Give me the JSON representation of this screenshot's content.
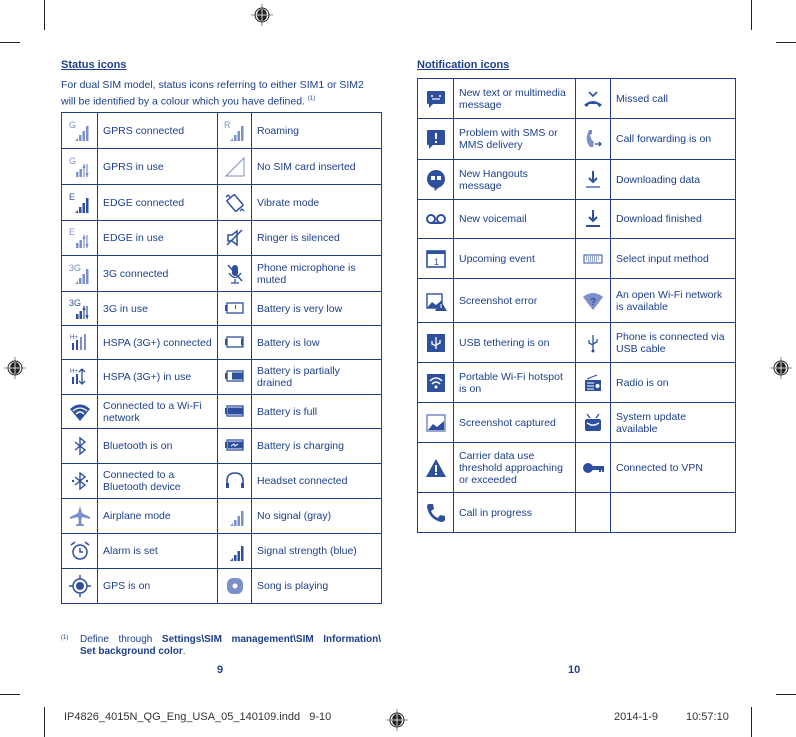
{
  "status_section": {
    "title": "Status icons",
    "intro": "For dual SIM model, status icons referring to either SIM1 or SIM2 will be identified by a colour which you have defined.",
    "intro_footnote_ref": "(1)",
    "rows": [
      {
        "left_icon": "gprs-connected-icon",
        "left": "GPRS connected",
        "right_icon": "roaming-icon",
        "right": "Roaming"
      },
      {
        "left_icon": "gprs-in-use-icon",
        "left": "GPRS in use",
        "right_icon": "no-sim-icon",
        "right": "No SIM card inserted"
      },
      {
        "left_icon": "edge-connected-icon",
        "left": "EDGE connected",
        "right_icon": "vibrate-icon",
        "right": "Vibrate mode"
      },
      {
        "left_icon": "edge-in-use-icon",
        "left": "EDGE in use",
        "right_icon": "ringer-silenced-icon",
        "right": "Ringer is silenced"
      },
      {
        "left_icon": "3g-connected-icon",
        "left": "3G connected",
        "right_icon": "mic-muted-icon",
        "right": "Phone microphone is muted"
      },
      {
        "left_icon": "3g-in-use-icon",
        "left": "3G in use",
        "right_icon": "battery-very-low-icon",
        "right": "Battery is very low"
      },
      {
        "left_icon": "hspa-connected-icon",
        "left": "HSPA (3G+) connected",
        "right_icon": "battery-low-icon",
        "right": "Battery is low"
      },
      {
        "left_icon": "hspa-in-use-icon",
        "left": "HSPA (3G+) in use",
        "right_icon": "battery-partial-icon",
        "right": "Battery is partially drained"
      },
      {
        "left_icon": "wifi-icon",
        "left": "Connected to a Wi-Fi network",
        "right_icon": "battery-full-icon",
        "right": "Battery is full"
      },
      {
        "left_icon": "bluetooth-icon",
        "left": "Bluetooth is on",
        "right_icon": "battery-charging-icon",
        "right": "Battery is charging"
      },
      {
        "left_icon": "bluetooth-connected-icon",
        "left": "Connected to a Bluetooth device",
        "right_icon": "headset-icon",
        "right": "Headset connected"
      },
      {
        "left_icon": "airplane-icon",
        "left": "Airplane mode",
        "right_icon": "no-signal-icon",
        "right": "No signal (gray)"
      },
      {
        "left_icon": "alarm-icon",
        "left": "Alarm is set",
        "right_icon": "signal-strength-icon",
        "right": "Signal strength (blue)"
      },
      {
        "left_icon": "gps-icon",
        "left": "GPS is on",
        "right_icon": "song-playing-icon",
        "right": "Song is playing"
      }
    ]
  },
  "notification_section": {
    "title": "Notification icons",
    "rows": [
      {
        "left_icon": "message-icon",
        "left": "New text or multimedia message",
        "right_icon": "missed-call-icon",
        "right": "Missed call"
      },
      {
        "left_icon": "sms-problem-icon",
        "left": "Problem with SMS or MMS delivery",
        "right_icon": "call-forwarding-icon",
        "right": "Call forwarding is on"
      },
      {
        "left_icon": "hangouts-icon",
        "left": "New Hangouts message",
        "right_icon": "downloading-icon",
        "right": "Downloading data"
      },
      {
        "left_icon": "voicemail-icon",
        "left": "New voicemail",
        "right_icon": "download-finished-icon",
        "right": "Download finished"
      },
      {
        "left_icon": "calendar-icon",
        "left": "Upcoming event",
        "right_icon": "keyboard-icon",
        "right": "Select input method"
      },
      {
        "left_icon": "screenshot-error-icon",
        "left": "Screenshot error",
        "right_icon": "open-wifi-icon",
        "right": "An open Wi-Fi network is available"
      },
      {
        "left_icon": "usb-tethering-icon",
        "left": "USB tethering is on",
        "right_icon": "usb-icon",
        "right": "Phone is connected via USB cable"
      },
      {
        "left_icon": "hotspot-icon",
        "left": "Portable Wi-Fi hotspot is on",
        "right_icon": "radio-icon",
        "right": "Radio is on"
      },
      {
        "left_icon": "screenshot-icon",
        "left": "Screenshot captured",
        "right_icon": "system-update-icon",
        "right": "System update available"
      },
      {
        "left_icon": "warning-icon",
        "left": "Carrier data use threshold approaching or exceeded",
        "right_icon": "vpn-key-icon",
        "right": "Connected to VPN"
      },
      {
        "left_icon": "phone-icon",
        "left": "Call in progress",
        "right_icon": "",
        "right": ""
      }
    ]
  },
  "footnote": {
    "mark": "(1)",
    "prefix": "Define through ",
    "path": "Settings\\SIM management\\SIM Information\\",
    "path2": "Set background color",
    "suffix": "."
  },
  "page_numbers": {
    "left": "9",
    "right": "10"
  },
  "slug": {
    "filename": "IP4826_4015N_QG_Eng_USA_05_140109.indd   9-10",
    "date": "2014-1-9",
    "time": "10:57:10"
  },
  "colors": {
    "text": "#1d3f8c",
    "icon": "#2e4f9e",
    "icon_light": "#7d8fc9"
  }
}
